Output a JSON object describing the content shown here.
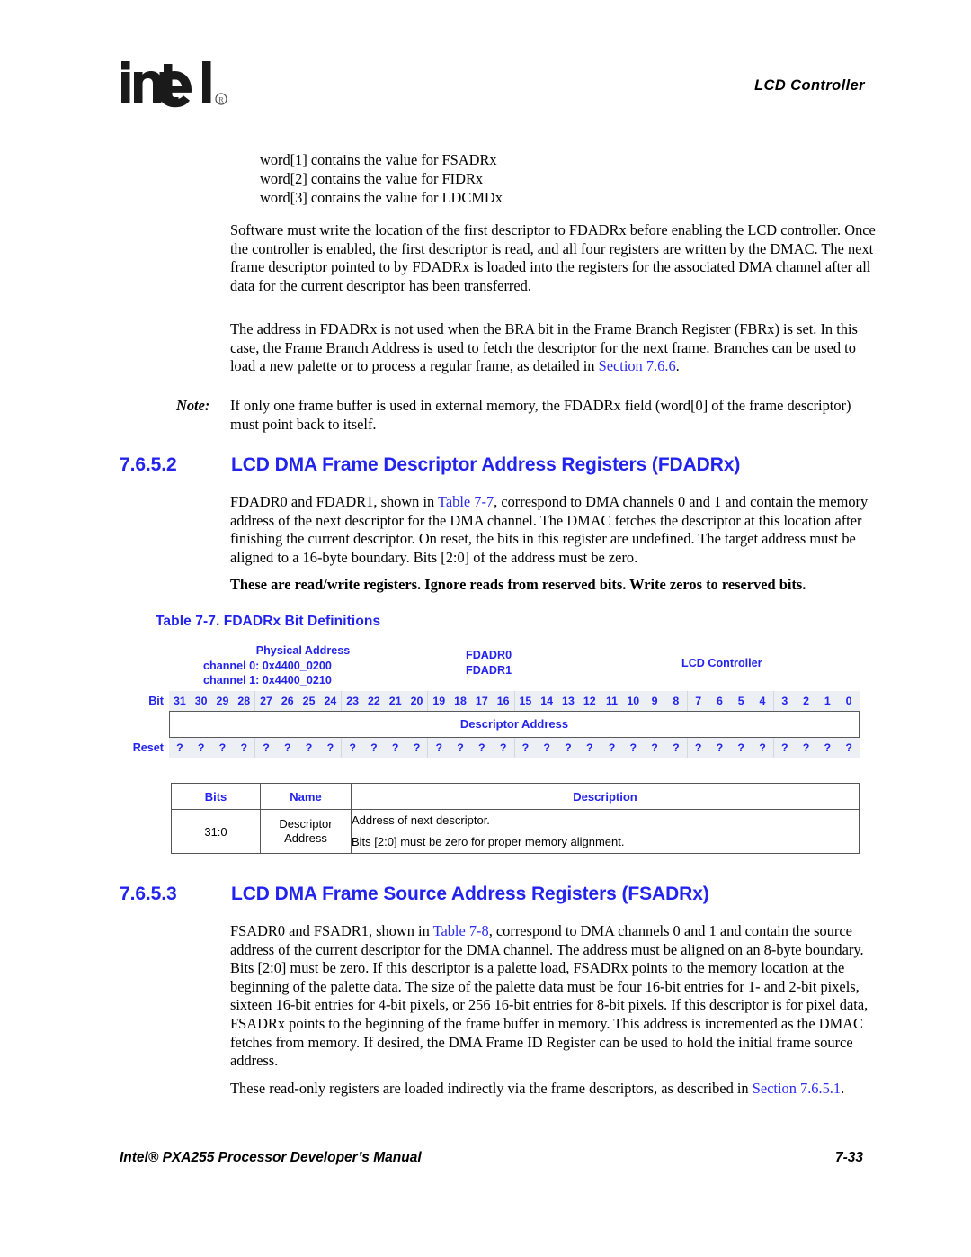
{
  "header": {
    "logo_text": "intel",
    "logo_mark": "registered-trademark",
    "running_title": "LCD Controller"
  },
  "body": {
    "word_list": [
      "word[1] contains the value for FSADRx",
      "word[2] contains the value for FIDRx",
      "word[3] contains the value for LDCMDx"
    ],
    "paragraph_software": "Software must write the location of the first descriptor to FDADRx before enabling the LCD controller. Once the controller is enabled, the first descriptor is read, and all four registers are written by the DMAC. The next frame descriptor pointed to by FDADRx is loaded into the registers for the associated DMA channel after all data for the current descriptor has been transferred.",
    "paragraph_fbr_part1": "The address in FDADRx is not used when the BRA bit in the Frame Branch Register (FBRx) is set. In this case, the Frame Branch Address is used to fetch the descriptor for the next frame. Branches can be used to load a new palette or to process a regular frame, as detailed in ",
    "paragraph_fbr_link": "Section 7.6.6",
    "paragraph_fbr_part2": ".",
    "note_label": "Note:",
    "note_text": "If only one frame buffer is used in external memory, the FDADRx field (word[0] of the frame descriptor) must point back to itself."
  },
  "section_fdadr": {
    "number": "7.6.5.2",
    "title": "LCD DMA Frame Descriptor Address Registers (FDADRx)",
    "paragraph_part1": "FDADR0 and FDADR1, shown in ",
    "paragraph_link": "Table 7-7",
    "paragraph_part2": ", correspond to DMA channels 0 and 1 and contain the memory address of the next descriptor for the DMA channel. The DMAC fetches the descriptor at this location after finishing the current descriptor. On reset, the bits in this register are undefined. The target address must be aligned to a 16-byte boundary. Bits [2:0] of the address must be zero.",
    "access_note": "These are read/write registers. Ignore reads from reserved bits. Write zeros to reserved bits."
  },
  "table_7_7": {
    "caption": "Table 7-7. FDADRx Bit Definitions",
    "physical_address_label": "Physical Address",
    "physical_address_lines": [
      "channel 0: 0x4400_0200",
      "channel 1: 0x4400_0210"
    ],
    "register_names": [
      "FDADR0",
      "FDADR1"
    ],
    "unit": "LCD Controller",
    "bit_row_label": "Bit",
    "bit_numbers": [
      "31",
      "30",
      "29",
      "28",
      "27",
      "26",
      "25",
      "24",
      "23",
      "22",
      "21",
      "20",
      "19",
      "18",
      "17",
      "16",
      "15",
      "14",
      "13",
      "12",
      "11",
      "10",
      "9",
      "8",
      "7",
      "6",
      "5",
      "4",
      "3",
      "2",
      "1",
      "0"
    ],
    "field_label": "Descriptor Address",
    "reset_row_label": "Reset",
    "reset_values": [
      "?",
      "?",
      "?",
      "?",
      "?",
      "?",
      "?",
      "?",
      "?",
      "?",
      "?",
      "?",
      "?",
      "?",
      "?",
      "?",
      "?",
      "?",
      "?",
      "?",
      "?",
      "?",
      "?",
      "?",
      "?",
      "?",
      "?",
      "?",
      "?",
      "?",
      "?",
      "?"
    ],
    "columns": [
      "Bits",
      "Name",
      "Description"
    ],
    "rows": [
      {
        "bits": "31:0",
        "name": "Descriptor Address",
        "description": [
          "Address of next descriptor.",
          "Bits [2:0] must be zero for proper memory alignment."
        ]
      }
    ]
  },
  "section_fsadr": {
    "number": "7.6.5.3",
    "title": "LCD DMA Frame Source Address Registers (FSADRx)",
    "paragraph_part1": "FSADR0 and FSADR1, shown in ",
    "paragraph_link": "Table 7-8",
    "paragraph_part2": ", correspond to DMA channels 0 and 1 and contain the source address of the current descriptor for the DMA channel. The address must be aligned on an 8-byte boundary. Bits [2:0] must be zero. If this descriptor is a palette load, FSADRx points to the memory location at the beginning of the palette data. The size of the palette data must be four 16-bit entries for 1- and 2-bit pixels, sixteen 16-bit entries for 4-bit pixels, or 256 16-bit entries for 8-bit pixels. If this descriptor is for pixel data, FSADRx points to the beginning of the frame buffer in memory. This address is incremented as the DMAC fetches from memory. If desired, the DMA Frame ID Register can be used to hold the initial frame source address.",
    "readonly_part1": "These read-only registers are loaded indirectly via the frame descriptors, as described in ",
    "readonly_link": "Section 7.6.5.1",
    "readonly_part2": "."
  },
  "footer": {
    "manual_title": "Intel® PXA255 Processor Developer’s Manual",
    "page_number": "7-33"
  },
  "colors": {
    "link_blue": "#2b2bf0",
    "heading_blue": "#2323ee",
    "grid_fill": "#eceff3",
    "grid_border": "#555555"
  }
}
